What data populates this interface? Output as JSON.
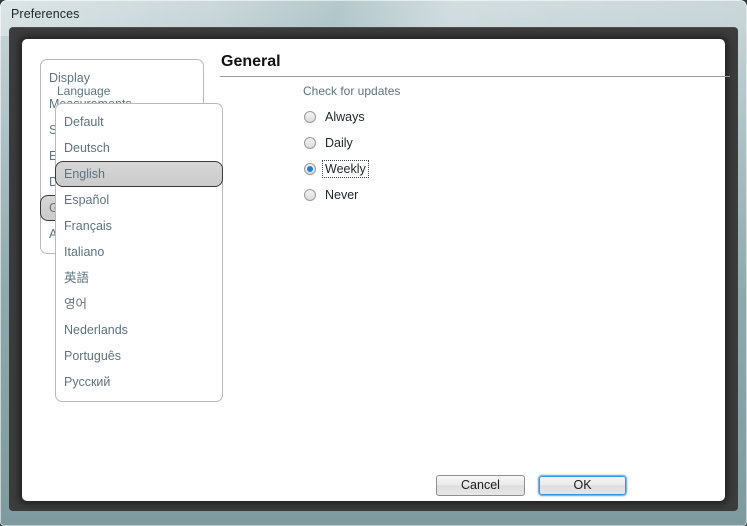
{
  "window": {
    "title": "Preferences"
  },
  "sidebar": {
    "items": [
      {
        "label": "Display",
        "selected": false
      },
      {
        "label": "Measurements",
        "selected": false
      },
      {
        "label": "Selection",
        "selected": false
      },
      {
        "label": "Editing",
        "selected": false
      },
      {
        "label": "Defaults",
        "selected": false
      },
      {
        "label": "General",
        "selected": true
      },
      {
        "label": "Advanced",
        "selected": false
      }
    ]
  },
  "main": {
    "page_title": "General",
    "language": {
      "label": "Language",
      "selected": "English",
      "options": [
        {
          "label": "Default",
          "selected": false
        },
        {
          "label": "Deutsch",
          "selected": false
        },
        {
          "label": "English",
          "selected": true
        },
        {
          "label": "Español",
          "selected": false
        },
        {
          "label": "Français",
          "selected": false
        },
        {
          "label": "Italiano",
          "selected": false
        },
        {
          "label": "英語",
          "selected": false
        },
        {
          "label": "영어",
          "selected": false
        },
        {
          "label": "Nederlands",
          "selected": false
        },
        {
          "label": "Português",
          "selected": false
        },
        {
          "label": "Русский",
          "selected": false
        }
      ]
    },
    "updates": {
      "label": "Check for updates",
      "selected": "Weekly",
      "options": [
        {
          "label": "Always",
          "selected": false,
          "focused": false
        },
        {
          "label": "Daily",
          "selected": false,
          "focused": false
        },
        {
          "label": "Weekly",
          "selected": true,
          "focused": true
        },
        {
          "label": "Never",
          "selected": false,
          "focused": false
        }
      ]
    }
  },
  "footer": {
    "cancel_label": "Cancel",
    "ok_label": "OK"
  },
  "colors": {
    "accent_blue": "#3399dd",
    "radio_dot": "#1f7fd0",
    "list_text": "#5d7381",
    "selected_fill": "#d0d0d0",
    "frame": "#3c3c3c",
    "titlebar_glass": "#8fa9ad"
  }
}
